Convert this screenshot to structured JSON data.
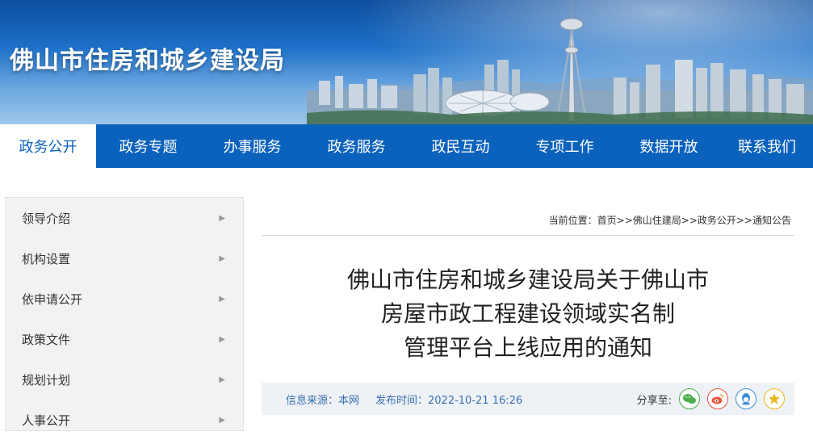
{
  "header": {
    "site_title": "佛山市住房和城乡建设局"
  },
  "nav": {
    "items": [
      {
        "label": "政务公开",
        "active": true
      },
      {
        "label": "政务专题"
      },
      {
        "label": "办事服务"
      },
      {
        "label": "政务服务"
      },
      {
        "label": "政民互动"
      },
      {
        "label": "专项工作"
      },
      {
        "label": "数据开放"
      },
      {
        "label": "联系我们"
      }
    ]
  },
  "sidebar": {
    "items": [
      {
        "label": "领导介绍"
      },
      {
        "label": "机构设置"
      },
      {
        "label": "依申请公开"
      },
      {
        "label": "政策文件"
      },
      {
        "label": "规划计划"
      },
      {
        "label": "人事公开"
      }
    ],
    "arrow_icon": "chevron-right-icon"
  },
  "breadcrumb": {
    "text": "当前位置：首页>>佛山住建局>>政务公开>>通知公告"
  },
  "article": {
    "title_line1": "佛山市住房和城乡建设局关于佛山市",
    "title_line2": "房屋市政工程建设领域实名制",
    "title_line3": "管理平台上线应用的通知",
    "source": "信息来源：本网",
    "publish_time": "发布时间：2022-10-21 16:26",
    "share_label": "分享至:"
  },
  "share": {
    "icons": [
      "wechat-icon",
      "weibo-icon",
      "qq-icon",
      "qzone-icon"
    ]
  },
  "colors": {
    "nav_bg": "#0b62bd",
    "sidebar_bg": "#f2f2f2",
    "info_bar_bg": "#eef1f5",
    "info_text": "#3a6fb0"
  }
}
